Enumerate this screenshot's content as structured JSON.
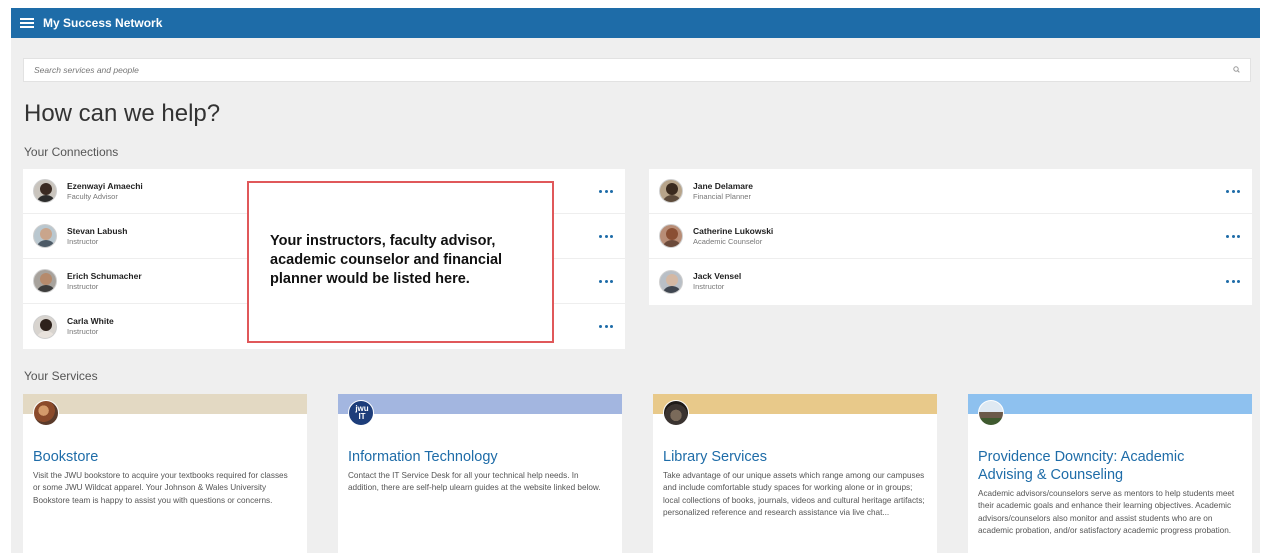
{
  "app": {
    "title": "My Success Network"
  },
  "search": {
    "placeholder": "Search services and people"
  },
  "page": {
    "heading": "How can we help?"
  },
  "sections": {
    "connections": "Your Connections",
    "services": "Your Services"
  },
  "connections": {
    "left": [
      {
        "name": "Ezenwayi Amaechi",
        "role": "Faculty Advisor"
      },
      {
        "name": "Stevan Labush",
        "role": "Instructor"
      },
      {
        "name": "Erich Schumacher",
        "role": "Instructor"
      },
      {
        "name": "Carla White",
        "role": "Instructor"
      }
    ],
    "right": [
      {
        "name": "Jane Delamare",
        "role": "Financial Planner"
      },
      {
        "name": "Catherine Lukowski",
        "role": "Academic Counselor"
      },
      {
        "name": "Jack Vensel",
        "role": "Instructor"
      }
    ]
  },
  "callout": {
    "text": "Your instructors, faculty advisor, academic counselor and financial planner would be listed here."
  },
  "services": [
    {
      "title": "Bookstore",
      "description": "Visit the JWU bookstore to acquire your textbooks required for classes or some JWU Wildcat apparel. Your Johnson & Wales University Bookstore team is happy to assist you with questions or concerns.",
      "band_color": "#e3d9c3"
    },
    {
      "title": "Information Technology",
      "logo_text": "jwu IT",
      "description": "Contact the IT Service Desk for all your technical help needs. In addition, there are self-help ulearn guides at the website linked below.",
      "band_color": "#a3b6e0"
    },
    {
      "title": "Library Services",
      "description": "Take advantage of our unique assets which range among our campuses and include comfortable study spaces for working alone or in groups; local collections of books, journals, videos and cultural heritage artifacts; personalized reference and research assistance via live chat...",
      "band_color": "#e8c98a"
    },
    {
      "title": "Providence Downcity: Academic Advising & Counseling",
      "description": "Academic advisors/counselors serve as mentors to help students meet their academic goals and enhance their learning objectives. Academic advisors/counselors also monitor and assist students who are on academic probation, and/or satisfactory academic progress probation.",
      "band_color": "#8ec1ef"
    }
  ],
  "colors": {
    "topbar": "#1e6ca8",
    "link": "#1e6ca8",
    "callout_border": "#e0585a",
    "background": "#efefef"
  },
  "icons": {
    "menu": "menu-icon",
    "search": "search-icon",
    "more": "more-icon"
  }
}
